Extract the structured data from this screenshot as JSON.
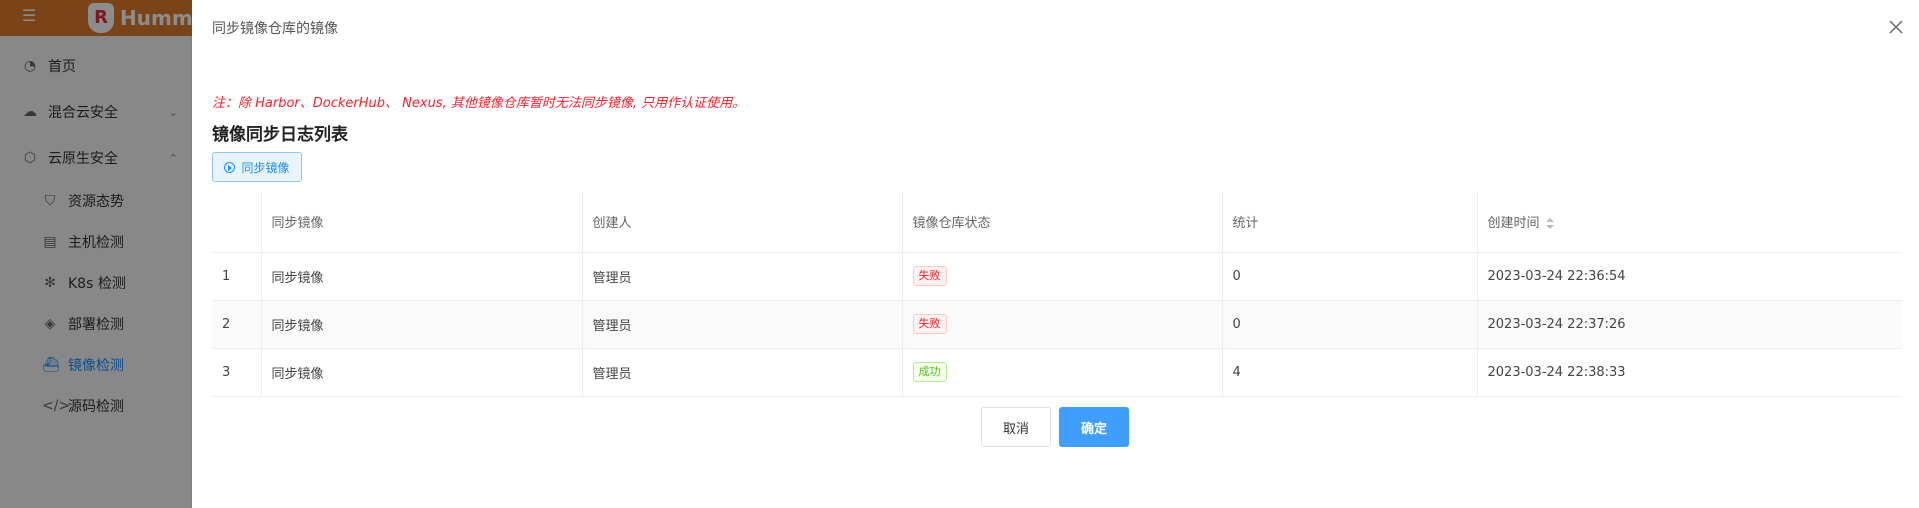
{
  "app": {
    "logo_text": "Humm",
    "logo_badge": "R",
    "nav": [
      {
        "label": "首页",
        "icon": "pie-chart-icon"
      },
      {
        "label": "混合云安全",
        "icon": "cloud-icon"
      },
      {
        "label": "云原生安全",
        "icon": "cloud-native-icon"
      },
      {
        "label": "资源态势",
        "icon": "shield-icon"
      },
      {
        "label": "主机检测",
        "icon": "server-icon"
      },
      {
        "label": "K8s 检测",
        "icon": "k8s-icon"
      },
      {
        "label": "部署检测",
        "icon": "layers-icon"
      },
      {
        "label": "镜像检测",
        "icon": "docker-icon"
      },
      {
        "label": "源码检测",
        "icon": "code-icon"
      }
    ]
  },
  "drawer": {
    "title": "同步镜像仓库的镜像",
    "note": "注：除 Harbor、DockerHub、 Nexus, 其他镜像仓库暂时无法同步镜像, 只用作认证使用。",
    "section_title": "镜像同步日志列表",
    "sync_button": "同步镜像",
    "table": {
      "columns": [
        "",
        "同步镜像",
        "创建人",
        "镜像仓库状态",
        "统计",
        "创建时间"
      ],
      "rows": [
        {
          "idx": "1",
          "name": "同步镜像",
          "creator": "管理员",
          "status": "失败",
          "status_type": "fail",
          "count": "0",
          "time": "2023-03-24 22:36:54"
        },
        {
          "idx": "2",
          "name": "同步镜像",
          "creator": "管理员",
          "status": "失败",
          "status_type": "fail",
          "count": "0",
          "time": "2023-03-24 22:37:26"
        },
        {
          "idx": "3",
          "name": "同步镜像",
          "creator": "管理员",
          "status": "成功",
          "status_type": "ok",
          "count": "4",
          "time": "2023-03-24 22:38:33"
        }
      ]
    },
    "cancel_label": "取消",
    "confirm_label": "确定"
  },
  "colors": {
    "accent": "#409eff",
    "topbar": "#e07b2c",
    "fail": "#f5222d",
    "success": "#52c41a"
  }
}
